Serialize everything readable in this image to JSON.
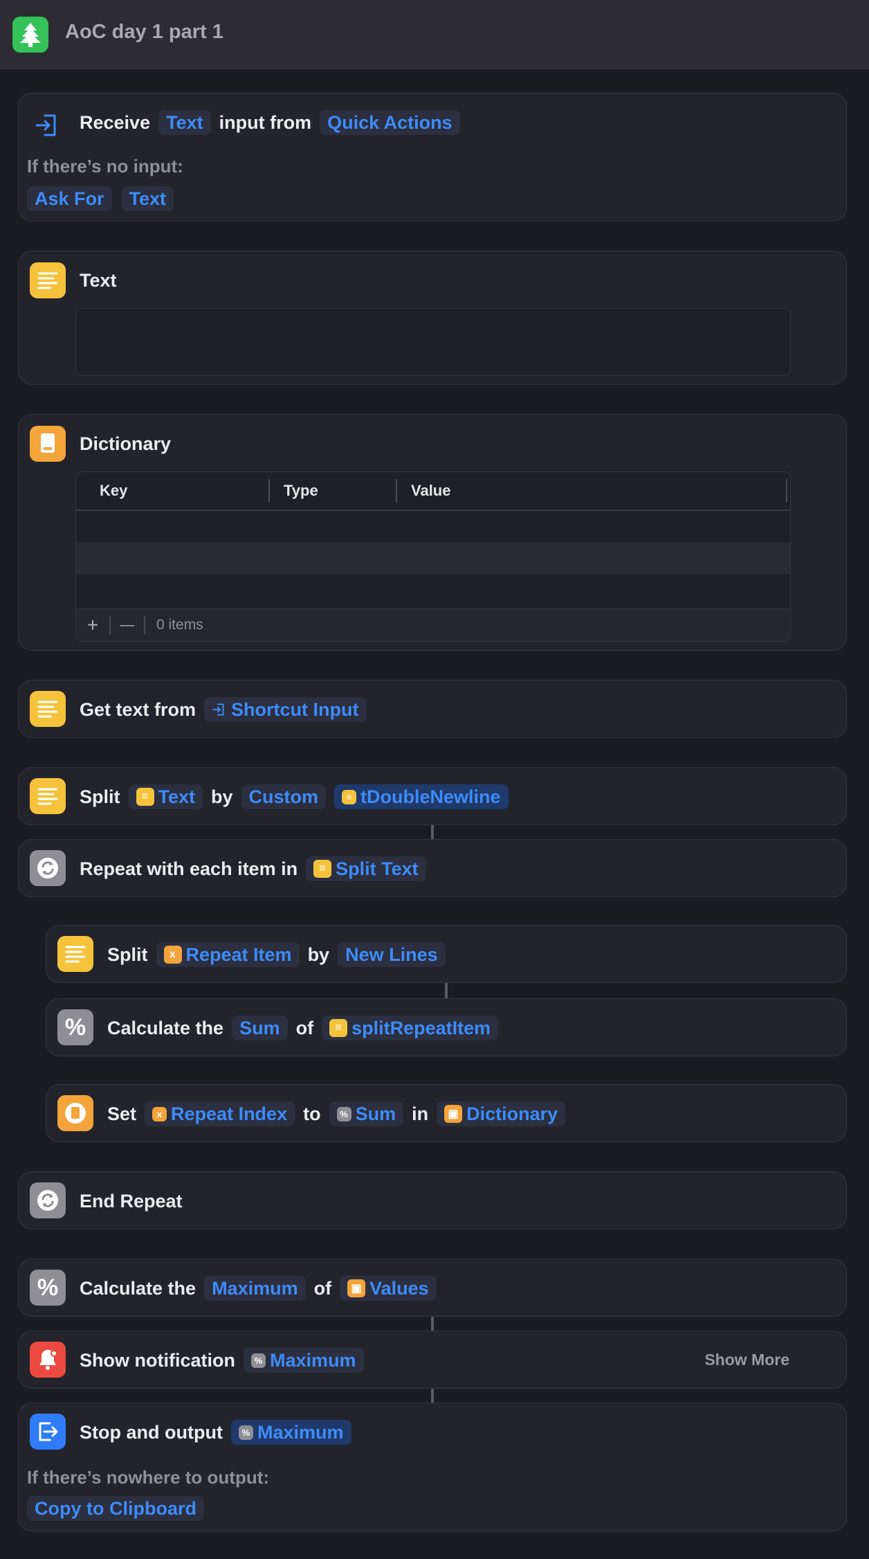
{
  "window": {
    "title": "AoC day 1 part 1",
    "app_icon": "tree-icon",
    "accent": "#34c259"
  },
  "receive": {
    "label1": "Receive",
    "type": "Text",
    "label2": "input from",
    "source": "Quick Actions",
    "no_input_label": "If there’s no input:",
    "opt1": "Ask For",
    "opt2": "Text",
    "icon": "input-arrow-icon"
  },
  "text_action": {
    "label": "Text",
    "value": "",
    "icon": "text-lines-icon"
  },
  "dictionary_action": {
    "label": "Dictionary",
    "headers": [
      "Key",
      "Type",
      "Value"
    ],
    "add": "+",
    "remove": "—",
    "count": "0 items",
    "icon": "book-icon"
  },
  "get_text": {
    "label": "Get text from",
    "source": "Shortcut Input"
  },
  "split1": {
    "label": "Split",
    "input": "Text",
    "by": "by",
    "mode": "Custom",
    "separator": "tDoubleNewline"
  },
  "repeat": {
    "label": "Repeat with each item in",
    "input": "Split Text",
    "icon": "repeat-icon"
  },
  "split2": {
    "label": "Split",
    "input": "Repeat Item",
    "by": "by",
    "mode": "New Lines"
  },
  "calc1": {
    "label1": "Calculate the",
    "op": "Sum",
    "of": "of",
    "input": "splitRepeatItem",
    "icon": "percent-icon"
  },
  "set": {
    "label": "Set",
    "key": "Repeat Index",
    "to": "to",
    "value": "Sum",
    "in": "in",
    "target": "Dictionary"
  },
  "end_repeat": {
    "label": "End Repeat"
  },
  "calc2": {
    "label1": "Calculate the",
    "op": "Maximum",
    "of": "of",
    "input": "Values"
  },
  "notify": {
    "label": "Show notification",
    "value": "Maximum",
    "show_more": "Show More",
    "icon": "bell-icon"
  },
  "stop": {
    "label": "Stop and output",
    "value": "Maximum",
    "nowhere_label": "If there’s nowhere to output:",
    "opt": "Copy to Clipboard",
    "icon": "exit-icon"
  },
  "glyphs": {
    "x": "x",
    "pct": "%"
  }
}
